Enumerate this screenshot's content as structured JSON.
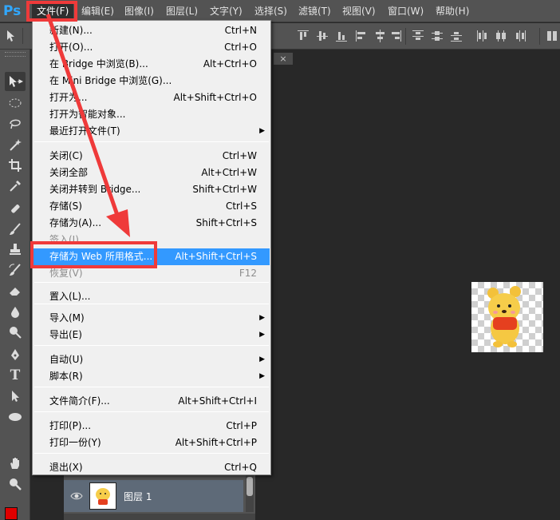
{
  "menubar": {
    "logo": "Ps",
    "items": [
      {
        "label": "文件(F)"
      },
      {
        "label": "编辑(E)"
      },
      {
        "label": "图像(I)"
      },
      {
        "label": "图层(L)"
      },
      {
        "label": "文字(Y)"
      },
      {
        "label": "选择(S)"
      },
      {
        "label": "滤镜(T)"
      },
      {
        "label": "视图(V)"
      },
      {
        "label": "窗口(W)"
      },
      {
        "label": "帮助(H)"
      }
    ]
  },
  "file_menu": {
    "items": [
      {
        "label": "新建(N)...",
        "shortcut": "Ctrl+N"
      },
      {
        "label": "打开(O)...",
        "shortcut": "Ctrl+O"
      },
      {
        "label": "在 Bridge 中浏览(B)...",
        "shortcut": "Alt+Ctrl+O"
      },
      {
        "label": "在 Mini Bridge 中浏览(G)...",
        "shortcut": ""
      },
      {
        "label": "打开为...",
        "shortcut": "Alt+Shift+Ctrl+O"
      },
      {
        "label": "打开为智能对象...",
        "shortcut": ""
      },
      {
        "label": "最近打开文件(T)",
        "shortcut": "",
        "submenu": true
      },
      {
        "label": "关闭(C)",
        "shortcut": "Ctrl+W"
      },
      {
        "label": "关闭全部",
        "shortcut": "Alt+Ctrl+W"
      },
      {
        "label": "关闭并转到 Bridge...",
        "shortcut": "Shift+Ctrl+W"
      },
      {
        "label": "存储(S)",
        "shortcut": "Ctrl+S"
      },
      {
        "label": "存储为(A)...",
        "shortcut": "Shift+Ctrl+S"
      },
      {
        "label": "签入(I)...",
        "shortcut": "",
        "disabled": true
      },
      {
        "label": "存储为 Web 所用格式...",
        "shortcut": "Alt+Shift+Ctrl+S",
        "highlighted": true
      },
      {
        "label": "恢复(V)",
        "shortcut": "F12",
        "disabled": true
      },
      {
        "label": "置入(L)...",
        "shortcut": ""
      },
      {
        "label": "导入(M)",
        "shortcut": "",
        "submenu": true
      },
      {
        "label": "导出(E)",
        "shortcut": "",
        "submenu": true
      },
      {
        "label": "自动(U)",
        "shortcut": "",
        "submenu": true
      },
      {
        "label": "脚本(R)",
        "shortcut": "",
        "submenu": true
      },
      {
        "label": "文件简介(F)...",
        "shortcut": "Alt+Shift+Ctrl+I"
      },
      {
        "label": "打印(P)...",
        "shortcut": "Ctrl+P"
      },
      {
        "label": "打印一份(Y)",
        "shortcut": "Alt+Shift+Ctrl+P"
      },
      {
        "label": "退出(X)",
        "shortcut": "Ctrl+Q"
      }
    ],
    "submenu_arrow": "▶"
  },
  "document": {
    "tab_close": "×"
  },
  "layers": {
    "layer_name": "图层 1"
  },
  "colors": {
    "accent_highlight": "#3399ff",
    "annotation_red": "#ef3a3a",
    "foreground": "#e00000",
    "background": "#ffffff"
  }
}
